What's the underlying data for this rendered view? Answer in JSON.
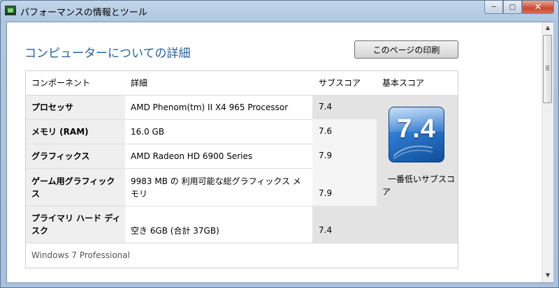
{
  "window": {
    "title": "パフォーマンスの情報とツール",
    "minimize_glyph": "─",
    "maximize_glyph": "□",
    "close_glyph": "✕"
  },
  "page": {
    "heading": "コンピューターについての詳細",
    "print_button_label": "このページの印刷"
  },
  "table": {
    "headers": {
      "component": "コンポーネント",
      "detail": "詳細",
      "subscore": "サブスコア",
      "basescore": "基本スコア"
    },
    "rows": [
      {
        "component": "プロセッサ",
        "detail": "AMD Phenom(tm) II X4 965 Processor",
        "subscore": "7.4"
      },
      {
        "component": "メモリ (RAM)",
        "detail": "16.0 GB",
        "subscore": "7.6"
      },
      {
        "component": "グラフィックス",
        "detail": "AMD Radeon HD 6900 Series",
        "subscore": "7.9"
      },
      {
        "component": "ゲーム用グラフィックス",
        "detail": "9983 MB の 利用可能な総グラフィックス メモリ",
        "subscore": "7.9"
      },
      {
        "component": "プライマリ ハード ディスク",
        "detail": "空き 6GB (合計 37GB)",
        "subscore": "7.4"
      }
    ],
    "base_score": "7.4",
    "base_score_caption": "一番低いサブスコア",
    "os_name": "Windows 7 Professional"
  },
  "scrollbar": {
    "up_glyph": "▲",
    "down_glyph": "▼"
  },
  "colors": {
    "heading": "#2a6199",
    "row_shade": "#efefef",
    "score_tile": "#2f7ad0"
  }
}
